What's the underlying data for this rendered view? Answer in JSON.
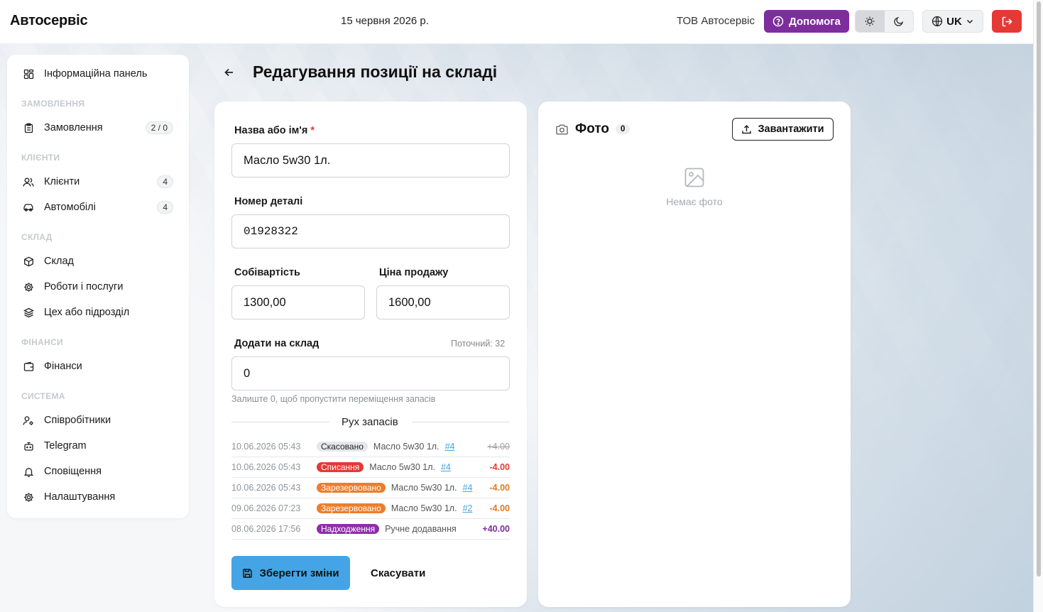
{
  "header": {
    "brand": "Автосервіс",
    "date": "15 червня 2026 р.",
    "company": "ТОВ Автосервіс",
    "help_label": "Допомога",
    "lang_label": "UK",
    "help_color": "#7d2e9c",
    "logout_color": "#e53935"
  },
  "sidebar": {
    "dashboard": "Інформаційна панель",
    "section_orders": "ЗАМОВЛЕННЯ",
    "orders": "Замовлення",
    "orders_badge": "2 / 0",
    "section_clients": "КЛІЄНТИ",
    "clients": "Клієнти",
    "clients_badge": "4",
    "cars": "Автомобілі",
    "cars_badge": "4",
    "section_stock": "СКЛАД",
    "stock": "Склад",
    "services": "Роботи і послуги",
    "workshop": "Цех або підрозділ",
    "section_finance": "ФІНАНСИ",
    "finance": "Фінанси",
    "section_system": "СИСТЕМА",
    "employees": "Співробітники",
    "telegram": "Telegram",
    "notifications": "Сповіщення",
    "settings": "Налаштування"
  },
  "page": {
    "title": "Редагування позиції на складі"
  },
  "form": {
    "name_label": "Назва або ім'я",
    "name_required": "*",
    "name_value": "Масло 5w30 1л.",
    "part_label": "Номер деталі",
    "part_value": "01928322",
    "cost_label": "Собівартість",
    "cost_value": "1300,00",
    "price_label": "Ціна продажу",
    "price_value": "1600,00",
    "add_label": "Додати на склад",
    "current_stock": "Поточний: 32",
    "add_value": "0",
    "add_hint": "Залиште 0, щоб пропустити переміщення запасів",
    "movements_title": "Рух запасів",
    "movements": [
      {
        "date": "10.06.2026 05:43",
        "type": "Скасовано",
        "name": "Масло 5w30 1л.",
        "link": "#4",
        "amount": "+4.00"
      },
      {
        "date": "10.06.2026 05:43",
        "type": "Списання",
        "name": "Масло 5w30 1л.",
        "link": "#4",
        "amount": "-4.00"
      },
      {
        "date": "10.06.2026 05:43",
        "type": "Зарезервовано",
        "name": "Масло 5w30 1л.",
        "link": "#4",
        "amount": "-4.00"
      },
      {
        "date": "09.06.2026 07:23",
        "type": "Зарезервовано",
        "name": "Масло 5w30 1л.",
        "link": "#2",
        "amount": "-4.00"
      },
      {
        "date": "08.06.2026 17:56",
        "type": "Надходження",
        "name": "Ручне додавання",
        "link": "",
        "amount": "+40.00"
      }
    ],
    "save_label": "Зберегти зміни",
    "cancel_label": "Скасувати"
  },
  "photo": {
    "title": "Фото",
    "count": "0",
    "upload_label": "Завантажити",
    "empty_text": "Немає фото"
  }
}
